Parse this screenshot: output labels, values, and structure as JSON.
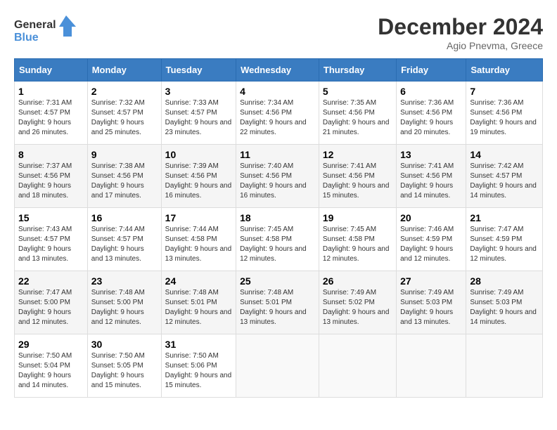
{
  "header": {
    "logo_line1": "General",
    "logo_line2": "Blue",
    "month": "December 2024",
    "location": "Agio Pnevma, Greece"
  },
  "weekdays": [
    "Sunday",
    "Monday",
    "Tuesday",
    "Wednesday",
    "Thursday",
    "Friday",
    "Saturday"
  ],
  "weeks": [
    [
      {
        "day": "1",
        "sunrise": "Sunrise: 7:31 AM",
        "sunset": "Sunset: 4:57 PM",
        "daylight": "Daylight: 9 hours and 26 minutes."
      },
      {
        "day": "2",
        "sunrise": "Sunrise: 7:32 AM",
        "sunset": "Sunset: 4:57 PM",
        "daylight": "Daylight: 9 hours and 25 minutes."
      },
      {
        "day": "3",
        "sunrise": "Sunrise: 7:33 AM",
        "sunset": "Sunset: 4:57 PM",
        "daylight": "Daylight: 9 hours and 23 minutes."
      },
      {
        "day": "4",
        "sunrise": "Sunrise: 7:34 AM",
        "sunset": "Sunset: 4:56 PM",
        "daylight": "Daylight: 9 hours and 22 minutes."
      },
      {
        "day": "5",
        "sunrise": "Sunrise: 7:35 AM",
        "sunset": "Sunset: 4:56 PM",
        "daylight": "Daylight: 9 hours and 21 minutes."
      },
      {
        "day": "6",
        "sunrise": "Sunrise: 7:36 AM",
        "sunset": "Sunset: 4:56 PM",
        "daylight": "Daylight: 9 hours and 20 minutes."
      },
      {
        "day": "7",
        "sunrise": "Sunrise: 7:36 AM",
        "sunset": "Sunset: 4:56 PM",
        "daylight": "Daylight: 9 hours and 19 minutes."
      }
    ],
    [
      {
        "day": "8",
        "sunrise": "Sunrise: 7:37 AM",
        "sunset": "Sunset: 4:56 PM",
        "daylight": "Daylight: 9 hours and 18 minutes."
      },
      {
        "day": "9",
        "sunrise": "Sunrise: 7:38 AM",
        "sunset": "Sunset: 4:56 PM",
        "daylight": "Daylight: 9 hours and 17 minutes."
      },
      {
        "day": "10",
        "sunrise": "Sunrise: 7:39 AM",
        "sunset": "Sunset: 4:56 PM",
        "daylight": "Daylight: 9 hours and 16 minutes."
      },
      {
        "day": "11",
        "sunrise": "Sunrise: 7:40 AM",
        "sunset": "Sunset: 4:56 PM",
        "daylight": "Daylight: 9 hours and 16 minutes."
      },
      {
        "day": "12",
        "sunrise": "Sunrise: 7:41 AM",
        "sunset": "Sunset: 4:56 PM",
        "daylight": "Daylight: 9 hours and 15 minutes."
      },
      {
        "day": "13",
        "sunrise": "Sunrise: 7:41 AM",
        "sunset": "Sunset: 4:56 PM",
        "daylight": "Daylight: 9 hours and 14 minutes."
      },
      {
        "day": "14",
        "sunrise": "Sunrise: 7:42 AM",
        "sunset": "Sunset: 4:57 PM",
        "daylight": "Daylight: 9 hours and 14 minutes."
      }
    ],
    [
      {
        "day": "15",
        "sunrise": "Sunrise: 7:43 AM",
        "sunset": "Sunset: 4:57 PM",
        "daylight": "Daylight: 9 hours and 13 minutes."
      },
      {
        "day": "16",
        "sunrise": "Sunrise: 7:44 AM",
        "sunset": "Sunset: 4:57 PM",
        "daylight": "Daylight: 9 hours and 13 minutes."
      },
      {
        "day": "17",
        "sunrise": "Sunrise: 7:44 AM",
        "sunset": "Sunset: 4:58 PM",
        "daylight": "Daylight: 9 hours and 13 minutes."
      },
      {
        "day": "18",
        "sunrise": "Sunrise: 7:45 AM",
        "sunset": "Sunset: 4:58 PM",
        "daylight": "Daylight: 9 hours and 12 minutes."
      },
      {
        "day": "19",
        "sunrise": "Sunrise: 7:45 AM",
        "sunset": "Sunset: 4:58 PM",
        "daylight": "Daylight: 9 hours and 12 minutes."
      },
      {
        "day": "20",
        "sunrise": "Sunrise: 7:46 AM",
        "sunset": "Sunset: 4:59 PM",
        "daylight": "Daylight: 9 hours and 12 minutes."
      },
      {
        "day": "21",
        "sunrise": "Sunrise: 7:47 AM",
        "sunset": "Sunset: 4:59 PM",
        "daylight": "Daylight: 9 hours and 12 minutes."
      }
    ],
    [
      {
        "day": "22",
        "sunrise": "Sunrise: 7:47 AM",
        "sunset": "Sunset: 5:00 PM",
        "daylight": "Daylight: 9 hours and 12 minutes."
      },
      {
        "day": "23",
        "sunrise": "Sunrise: 7:48 AM",
        "sunset": "Sunset: 5:00 PM",
        "daylight": "Daylight: 9 hours and 12 minutes."
      },
      {
        "day": "24",
        "sunrise": "Sunrise: 7:48 AM",
        "sunset": "Sunset: 5:01 PM",
        "daylight": "Daylight: 9 hours and 12 minutes."
      },
      {
        "day": "25",
        "sunrise": "Sunrise: 7:48 AM",
        "sunset": "Sunset: 5:01 PM",
        "daylight": "Daylight: 9 hours and 13 minutes."
      },
      {
        "day": "26",
        "sunrise": "Sunrise: 7:49 AM",
        "sunset": "Sunset: 5:02 PM",
        "daylight": "Daylight: 9 hours and 13 minutes."
      },
      {
        "day": "27",
        "sunrise": "Sunrise: 7:49 AM",
        "sunset": "Sunset: 5:03 PM",
        "daylight": "Daylight: 9 hours and 13 minutes."
      },
      {
        "day": "28",
        "sunrise": "Sunrise: 7:49 AM",
        "sunset": "Sunset: 5:03 PM",
        "daylight": "Daylight: 9 hours and 14 minutes."
      }
    ],
    [
      {
        "day": "29",
        "sunrise": "Sunrise: 7:50 AM",
        "sunset": "Sunset: 5:04 PM",
        "daylight": "Daylight: 9 hours and 14 minutes."
      },
      {
        "day": "30",
        "sunrise": "Sunrise: 7:50 AM",
        "sunset": "Sunset: 5:05 PM",
        "daylight": "Daylight: 9 hours and 15 minutes."
      },
      {
        "day": "31",
        "sunrise": "Sunrise: 7:50 AM",
        "sunset": "Sunset: 5:06 PM",
        "daylight": "Daylight: 9 hours and 15 minutes."
      },
      null,
      null,
      null,
      null
    ]
  ]
}
